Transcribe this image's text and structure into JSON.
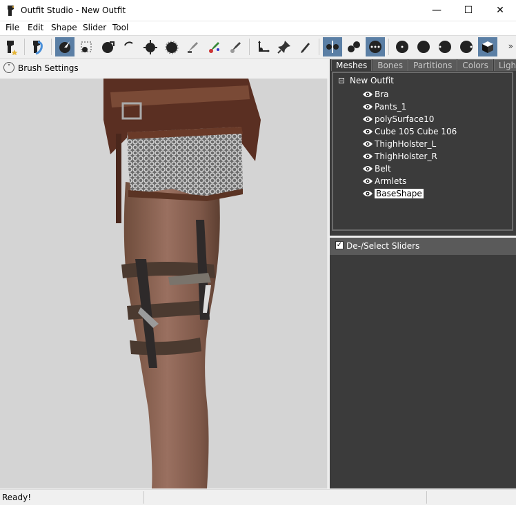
{
  "window": {
    "title": "Outfit Studio - New Outfit",
    "minimize": "—",
    "maximize": "☐",
    "close": "✕"
  },
  "menu": [
    "File",
    "Edit",
    "Shape",
    "Slider",
    "Tool"
  ],
  "toolbar": {
    "tools": [
      {
        "name": "select-tool-icon",
        "active": false
      },
      {
        "name": "transform-tool-icon",
        "active": false
      },
      {
        "name": "standard-brush-icon",
        "active": true
      },
      {
        "name": "mask-brush-icon",
        "active": false
      },
      {
        "name": "inflate-brush-icon",
        "active": false
      },
      {
        "name": "deflate-brush-icon",
        "active": false
      },
      {
        "name": "move-brush-icon",
        "active": false
      },
      {
        "name": "smooth-brush-icon",
        "active": false
      },
      {
        "name": "weight-brush-icon",
        "active": false
      },
      {
        "name": "color-brush-icon",
        "active": false
      },
      {
        "name": "alpha-brush-icon",
        "active": false
      },
      {
        "name": "transform-gizmo-icon",
        "active": false
      },
      {
        "name": "pivot-pin-icon",
        "active": false
      },
      {
        "name": "edit-pen-icon",
        "active": false
      },
      {
        "name": "mirror-x-icon",
        "active": true
      },
      {
        "name": "connected-only-icon",
        "active": false
      },
      {
        "name": "global-brush-icon",
        "active": true
      },
      {
        "name": "view-front-icon",
        "active": false
      },
      {
        "name": "view-back-icon",
        "active": false
      },
      {
        "name": "view-left-icon",
        "active": false
      },
      {
        "name": "view-right-icon",
        "active": false
      },
      {
        "name": "perspective-cube-icon",
        "active": true
      }
    ],
    "more": "»"
  },
  "brush_settings": {
    "label": "Brush Settings"
  },
  "panel": {
    "tabs": [
      {
        "label": "Meshes",
        "active": true
      },
      {
        "label": "Bones",
        "active": false
      },
      {
        "label": "Partitions",
        "active": false
      },
      {
        "label": "Colors",
        "active": false
      },
      {
        "label": "Lights",
        "active": false
      }
    ],
    "root": "New Outfit",
    "meshes": [
      {
        "label": "Bra",
        "selected": false
      },
      {
        "label": "Pants_1",
        "selected": false
      },
      {
        "label": "polySurface10",
        "selected": false
      },
      {
        "label": "Cube 105 Cube 106",
        "selected": false
      },
      {
        "label": "ThighHolster_L",
        "selected": false
      },
      {
        "label": "ThighHolster_R",
        "selected": false
      },
      {
        "label": "Belt",
        "selected": false
      },
      {
        "label": "Armlets",
        "selected": false
      },
      {
        "label": "BaseShape",
        "selected": true
      }
    ],
    "sliders_label": "De-/Select Sliders",
    "sliders_checked": true
  },
  "status": {
    "message": "Ready!"
  },
  "colors": {
    "accent": "#5b7fa5",
    "panel_bg": "#3b3b3b",
    "viewport_bg": "#d4d4d4"
  }
}
